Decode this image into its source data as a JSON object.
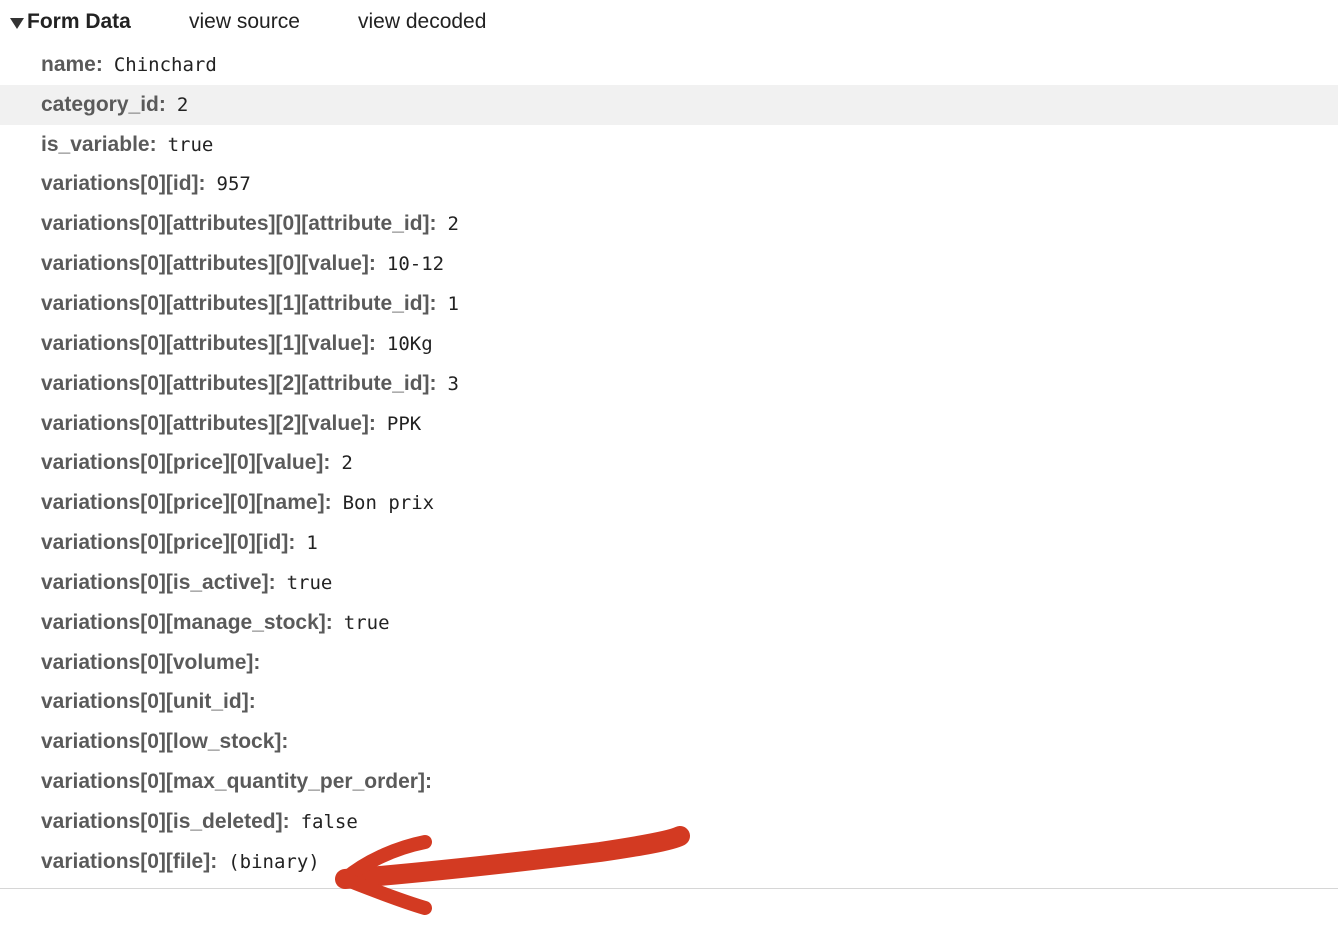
{
  "header": {
    "title": "Form Data",
    "view_source": "view source",
    "view_decoded": "view decoded"
  },
  "rows": [
    {
      "key": "name",
      "value": "Chinchard"
    },
    {
      "key": "category_id",
      "value": "2"
    },
    {
      "key": "is_variable",
      "value": "true"
    },
    {
      "key": "variations[0][id]",
      "value": "957"
    },
    {
      "key": "variations[0][attributes][0][attribute_id]",
      "value": "2"
    },
    {
      "key": "variations[0][attributes][0][value]",
      "value": "10-12"
    },
    {
      "key": "variations[0][attributes][1][attribute_id]",
      "value": "1"
    },
    {
      "key": "variations[0][attributes][1][value]",
      "value": "10Kg"
    },
    {
      "key": "variations[0][attributes][2][attribute_id]",
      "value": "3"
    },
    {
      "key": "variations[0][attributes][2][value]",
      "value": "PPK"
    },
    {
      "key": "variations[0][price][0][value]",
      "value": "2"
    },
    {
      "key": "variations[0][price][0][name]",
      "value": "Bon prix"
    },
    {
      "key": "variations[0][price][0][id]",
      "value": "1"
    },
    {
      "key": "variations[0][is_active]",
      "value": "true"
    },
    {
      "key": "variations[0][manage_stock]",
      "value": "true"
    },
    {
      "key": "variations[0][volume]",
      "value": ""
    },
    {
      "key": "variations[0][unit_id]",
      "value": ""
    },
    {
      "key": "variations[0][low_stock]",
      "value": ""
    },
    {
      "key": "variations[0][max_quantity_per_order]",
      "value": ""
    },
    {
      "key": "variations[0][is_deleted]",
      "value": "false"
    },
    {
      "key": "variations[0][file]",
      "value": "(binary)"
    }
  ],
  "annotation": {
    "arrow_color": "#d33a22",
    "icon": "red-arrow-annotation-icon"
  }
}
